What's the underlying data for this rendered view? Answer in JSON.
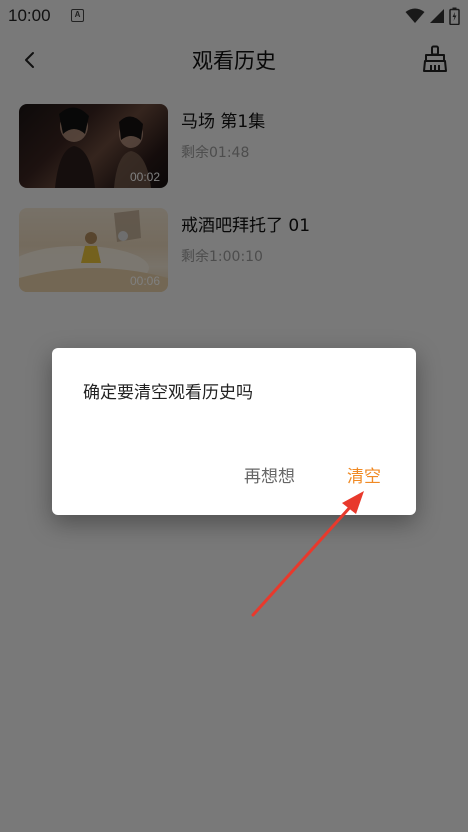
{
  "status_bar": {
    "time": "10:00",
    "notification_letter": "A"
  },
  "header": {
    "title": "观看历史",
    "back_icon": "chevron-left-icon",
    "clear_icon": "broom-icon"
  },
  "history": [
    {
      "title": "马场 第1集",
      "remaining": "剩余01:48",
      "duration": "00:02"
    },
    {
      "title": "戒酒吧拜托了 01",
      "remaining": "剩余1:00:10",
      "duration": "00:06"
    }
  ],
  "dialog": {
    "message": "确定要清空观看历史吗",
    "cancel_label": "再想想",
    "confirm_label": "清空"
  },
  "colors": {
    "accent": "#f08a24",
    "annotation_arrow": "#e8392c",
    "overlay": "rgba(0,0,0,0.5)"
  }
}
